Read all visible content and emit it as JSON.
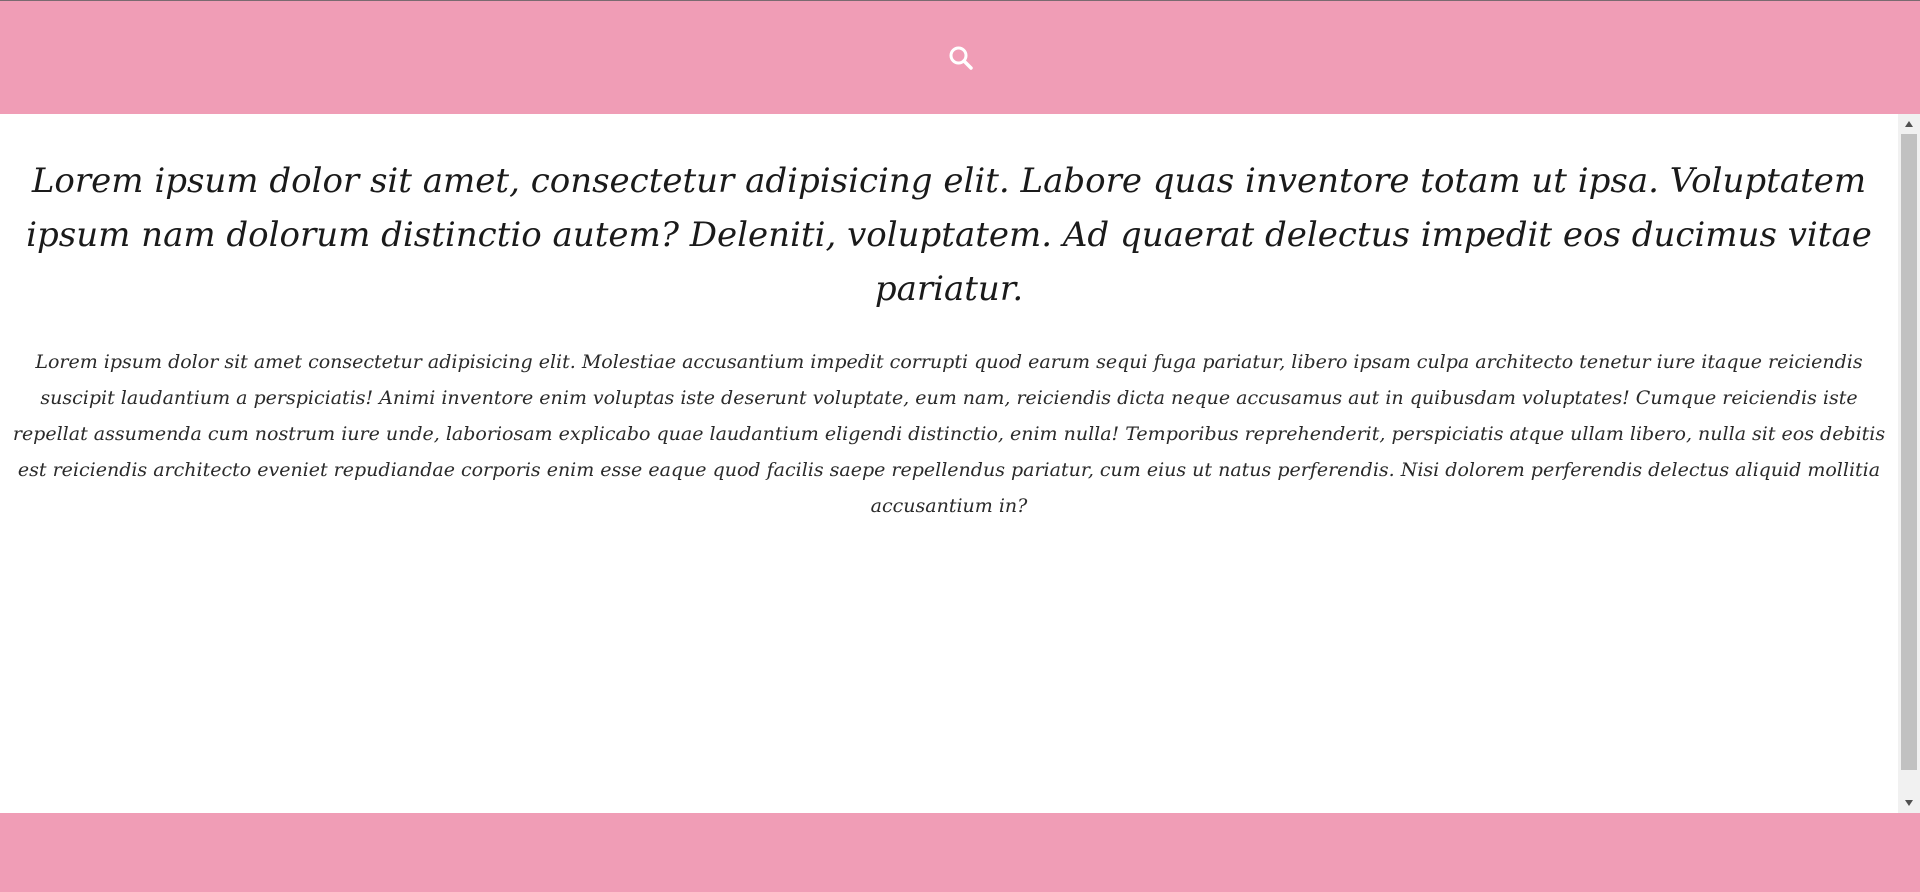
{
  "header": {
    "icon": "search-icon",
    "background": "#f09db6"
  },
  "main": {
    "heading": "Lorem ipsum dolor sit amet, consectetur adipisicing elit. Labore quas inventore totam ut ipsa. Voluptatem ipsum nam dolorum distinctio autem? Deleniti, voluptatem. Ad quaerat delectus impedit eos ducimus vitae pariatur.",
    "paragraph": "Lorem ipsum dolor sit amet consectetur adipisicing elit. Molestiae accusantium impedit corrupti quod earum sequi fuga pariatur, libero ipsam culpa architecto tenetur iure itaque reiciendis suscipit laudantium a perspiciatis! Animi inventore enim voluptas iste deserunt voluptate, eum nam, reiciendis dicta neque accusamus aut in quibusdam voluptates! Cumque reiciendis iste repellat assumenda cum nostrum iure unde, laboriosam explicabo quae laudantium eligendi distinctio, enim nulla! Temporibus reprehenderit, perspiciatis atque ullam libero, nulla sit eos debitis est reiciendis architecto eveniet repudiandae corporis enim esse eaque quod facilis saepe repellendus pariatur, cum eius ut natus perferendis. Nisi dolorem perferendis delectus aliquid mollitia accusantium in?"
  },
  "footer": {
    "background": "#f09db6"
  }
}
